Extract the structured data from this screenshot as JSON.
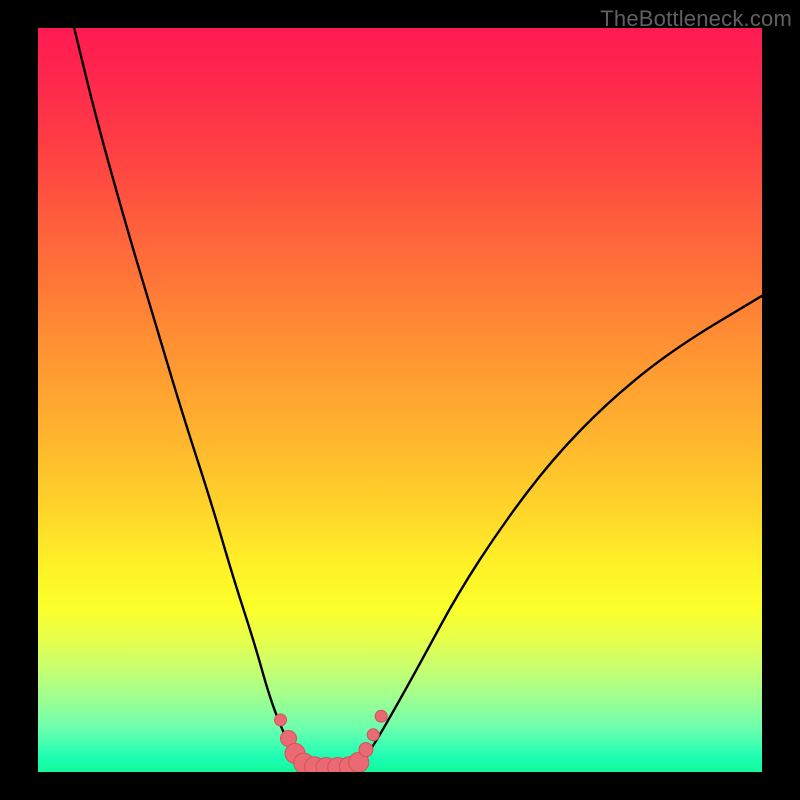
{
  "watermark": "TheBottleneck.com",
  "chart_data": {
    "type": "line",
    "title": "",
    "xlabel": "",
    "ylabel": "",
    "xlim": [
      0,
      100
    ],
    "ylim": [
      0,
      100
    ],
    "series": [
      {
        "name": "left-curve",
        "x": [
          5,
          8,
          12,
          16,
          20,
          24,
          27,
          30,
          32,
          34,
          35.5,
          37
        ],
        "y": [
          100,
          88,
          74,
          61,
          48,
          36,
          26,
          17,
          10,
          5,
          2.5,
          0.5
        ]
      },
      {
        "name": "right-curve",
        "x": [
          44,
          46,
          49,
          53,
          58,
          64,
          71,
          79,
          88,
          100
        ],
        "y": [
          0.5,
          3,
          8,
          15,
          24,
          33,
          42,
          50,
          57,
          64
        ]
      }
    ],
    "markers": [
      {
        "x": 33.5,
        "y": 7.0,
        "r": 6
      },
      {
        "x": 34.6,
        "y": 4.5,
        "r": 8
      },
      {
        "x": 35.5,
        "y": 2.5,
        "r": 10
      },
      {
        "x": 36.7,
        "y": 1.2,
        "r": 10
      },
      {
        "x": 38.2,
        "y": 0.7,
        "r": 10
      },
      {
        "x": 39.8,
        "y": 0.6,
        "r": 10
      },
      {
        "x": 41.4,
        "y": 0.6,
        "r": 10
      },
      {
        "x": 43.0,
        "y": 0.7,
        "r": 10
      },
      {
        "x": 44.3,
        "y": 1.3,
        "r": 10
      },
      {
        "x": 45.3,
        "y": 3.0,
        "r": 7
      },
      {
        "x": 46.3,
        "y": 5.0,
        "r": 6
      },
      {
        "x": 47.4,
        "y": 7.5,
        "r": 6
      }
    ],
    "colors": {
      "curve": "#000000",
      "marker_fill": "#e96a72",
      "marker_stroke": "#d94f58"
    }
  }
}
